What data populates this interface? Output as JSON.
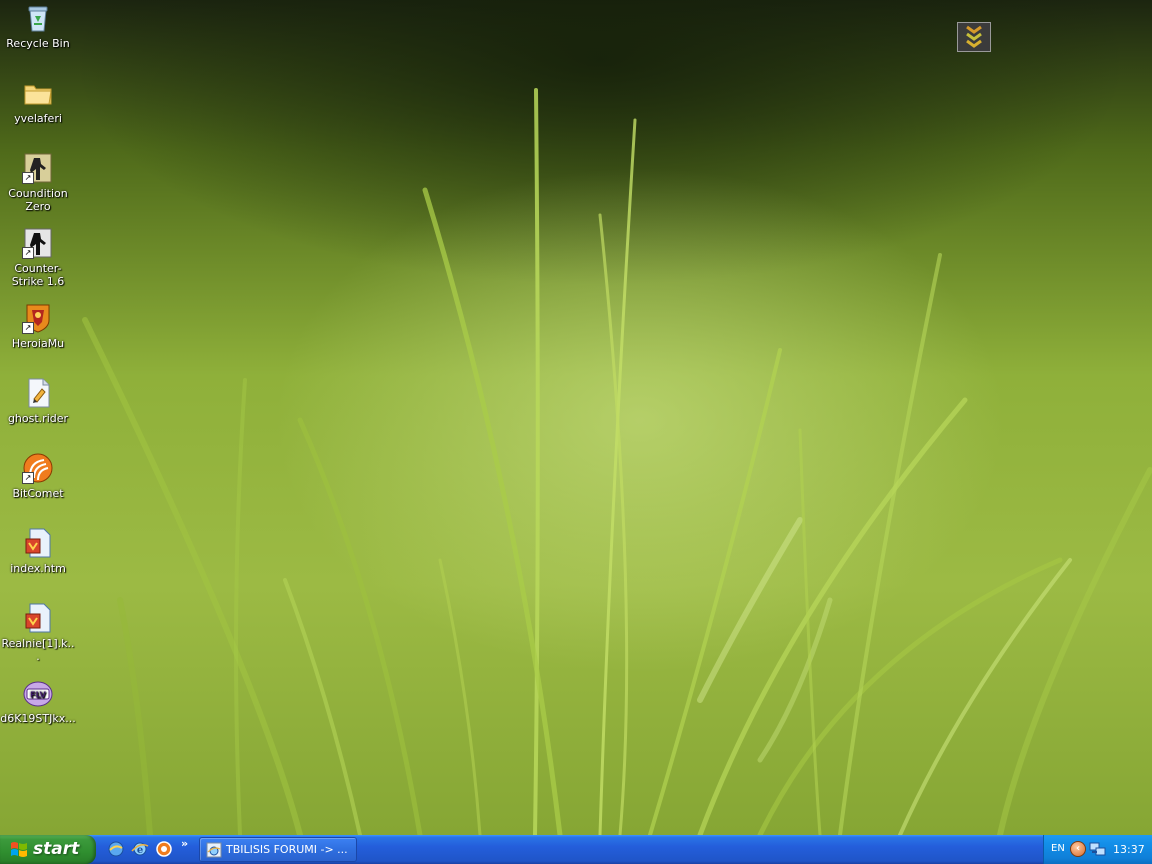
{
  "desktop": {
    "icons": [
      {
        "label": "Recycle Bin",
        "icon": "recycle-bin-icon"
      },
      {
        "label": "yvelaferi",
        "icon": "folder-icon"
      },
      {
        "label": "Coundition Zero",
        "icon": "condition-zero-icon"
      },
      {
        "label": "Counter-Strike 1.6",
        "icon": "counter-strike-icon"
      },
      {
        "label": "HeroiaMu",
        "icon": "heroiamu-icon"
      },
      {
        "label": "ghost.rider",
        "icon": "ghost-rider-file-icon"
      },
      {
        "label": "BitComet",
        "icon": "bitcomet-icon"
      },
      {
        "label": "index.htm",
        "icon": "html-file-icon"
      },
      {
        "label": "Realnie[1].k...",
        "icon": "html-file-icon"
      },
      {
        "label": "d6K19STJkx...",
        "icon": "flv-file-icon"
      }
    ]
  },
  "taskbar": {
    "start_label": "start",
    "quicklaunch_more": "»",
    "tasks": [
      {
        "label": "TBILISIS FORUMI -> ..."
      }
    ],
    "tray": {
      "language": "EN",
      "chevron": "‹",
      "clock": "13:37"
    }
  },
  "colors": {
    "taskbar_blue": "#245edb",
    "start_green": "#3c9a3c",
    "tray_blue": "#0f7fd8"
  }
}
